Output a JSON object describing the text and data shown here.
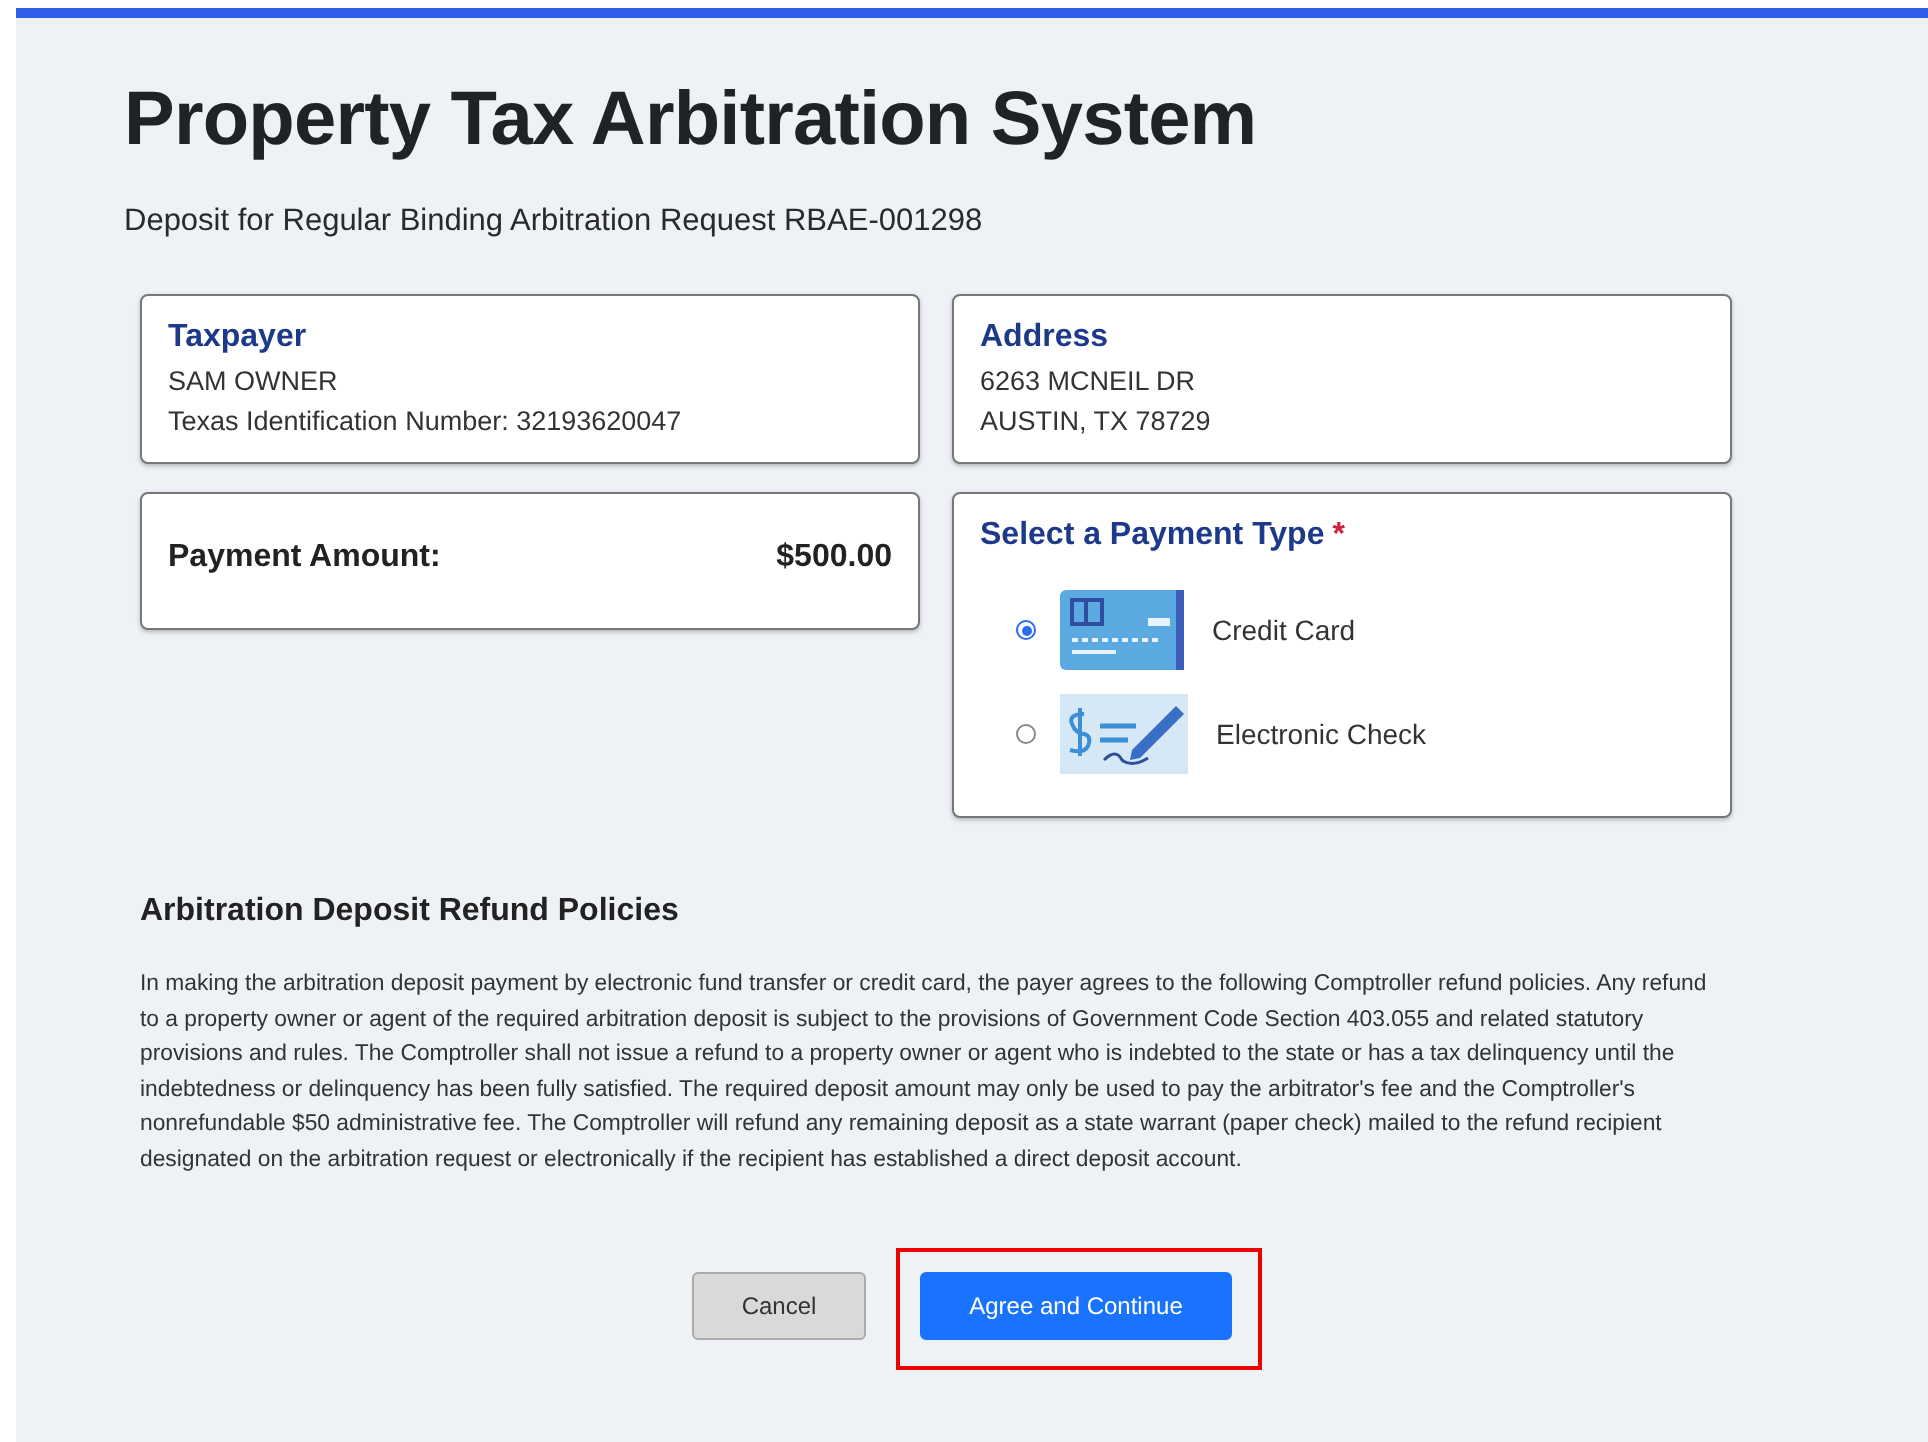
{
  "title": "Property Tax Arbitration System",
  "subtitle": "Deposit for Regular Binding Arbitration Request RBAE-001298",
  "taxpayer": {
    "heading": "Taxpayer",
    "lines": [
      "SAM OWNER",
      "Texas Identification Number: 32193620047"
    ]
  },
  "address": {
    "heading": "Address",
    "lines": [
      "6263 MCNEIL DR",
      "AUSTIN, TX 78729"
    ]
  },
  "payment_amount": {
    "label": "Payment Amount:",
    "value": "$500.00"
  },
  "payment_type": {
    "heading": "Select a Payment Type",
    "required_mark": "*",
    "options": [
      {
        "kind": "card",
        "label": "Credit Card",
        "selected": true
      },
      {
        "kind": "check",
        "label": "Electronic Check",
        "selected": false
      }
    ]
  },
  "policies": {
    "heading": "Arbitration Deposit Refund Policies",
    "text": "In making the arbitration deposit payment by electronic fund transfer or credit card, the payer agrees to the following Comptroller refund policies. Any refund to a property owner or agent of the required arbitration deposit is subject to the provisions of Government Code Section 403.055 and related statutory provisions and rules. The Comptroller shall not issue a refund to a property owner or agent who is indebted to the state or has a tax delinquency until the indebtedness or delinquency has been fully satisfied. The required deposit amount may only be used to pay the arbitrator's fee and the Comptroller's nonrefundable $50 administrative fee. The Comptroller will refund any remaining deposit as a state warrant (paper check) mailed to the refund recipient designated on the arbitration request or electronically if the recipient has established a direct deposit account."
  },
  "buttons": [
    {
      "kind": "secondary",
      "label": "Cancel",
      "highlighted": false
    },
    {
      "kind": "primary",
      "label": "Agree and Continue",
      "highlighted": true
    }
  ]
}
